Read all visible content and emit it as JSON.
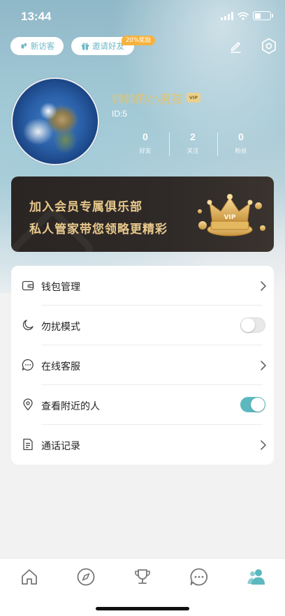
{
  "status_bar": {
    "time": "13:44"
  },
  "header": {
    "visitors_label": "新访客",
    "invite_label": "邀请好友",
    "invite_bonus": "20%奖励"
  },
  "profile": {
    "nickname": "帅帅的小男孩",
    "vip_badge": "VIP",
    "id_text": "ID:5",
    "stats": [
      {
        "value": "0",
        "label": "好友"
      },
      {
        "value": "2",
        "label": "关注"
      },
      {
        "value": "0",
        "label": "粉丝"
      }
    ]
  },
  "vip_banner": {
    "line1": "加入会员专属俱乐部",
    "line2": "私人管家带您领略更精彩",
    "crown_text": "VIP"
  },
  "menu": {
    "items": [
      {
        "label": "钱包管理",
        "icon": "wallet-icon",
        "control": "chevron"
      },
      {
        "label": "勿扰模式",
        "icon": "moon-icon",
        "control": "toggle",
        "on": false
      },
      {
        "label": "在线客服",
        "icon": "chat-bubble-icon",
        "control": "chevron"
      },
      {
        "label": "查看附近的人",
        "icon": "location-pin-icon",
        "control": "toggle",
        "on": true
      },
      {
        "label": "通话记录",
        "icon": "document-icon",
        "control": "chevron"
      }
    ]
  },
  "tabbar": {
    "tabs": [
      {
        "icon": "home-icon",
        "active": false
      },
      {
        "icon": "compass-icon",
        "active": false
      },
      {
        "icon": "trophy-icon",
        "active": false
      },
      {
        "icon": "chat-icon",
        "active": false
      },
      {
        "icon": "profile-icon",
        "active": true
      }
    ]
  },
  "colors": {
    "accent": "#5cb8bf",
    "gold": "#e6c46c",
    "banner_bg": "#2a2523",
    "bonus_tag": "#f6b23d"
  }
}
